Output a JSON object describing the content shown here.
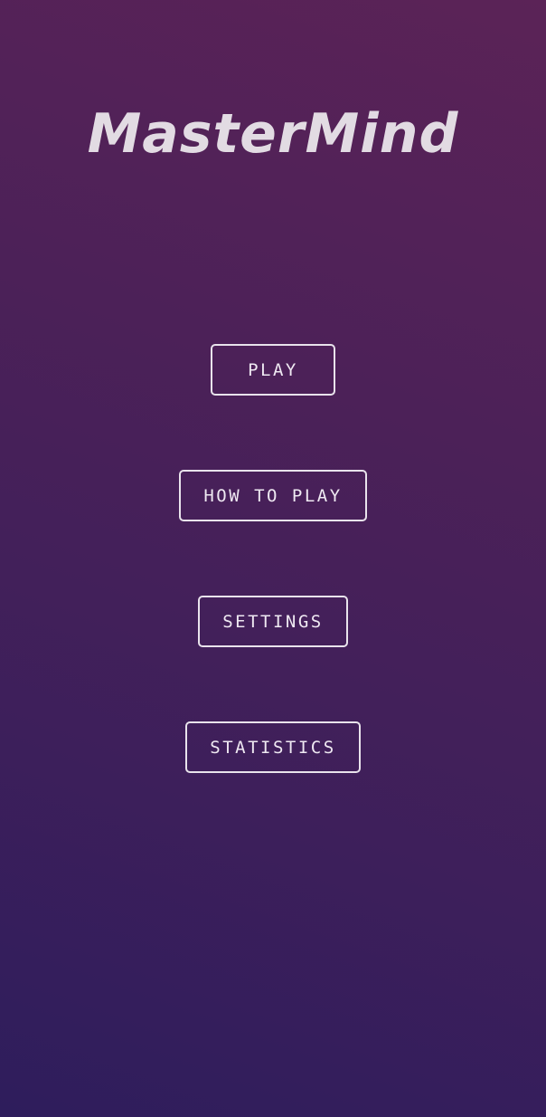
{
  "app": {
    "title": "MasterMind"
  },
  "menu": {
    "play_label": "PLAY",
    "how_to_play_label": "HOW TO PLAY",
    "settings_label": "SETTINGS",
    "statistics_label": "STATISTICS"
  },
  "colors": {
    "background_top": "#5b2357",
    "background_bottom": "#2e1d5c",
    "title_text": "#e2dbe3",
    "button_border": "#e9e3ec"
  }
}
